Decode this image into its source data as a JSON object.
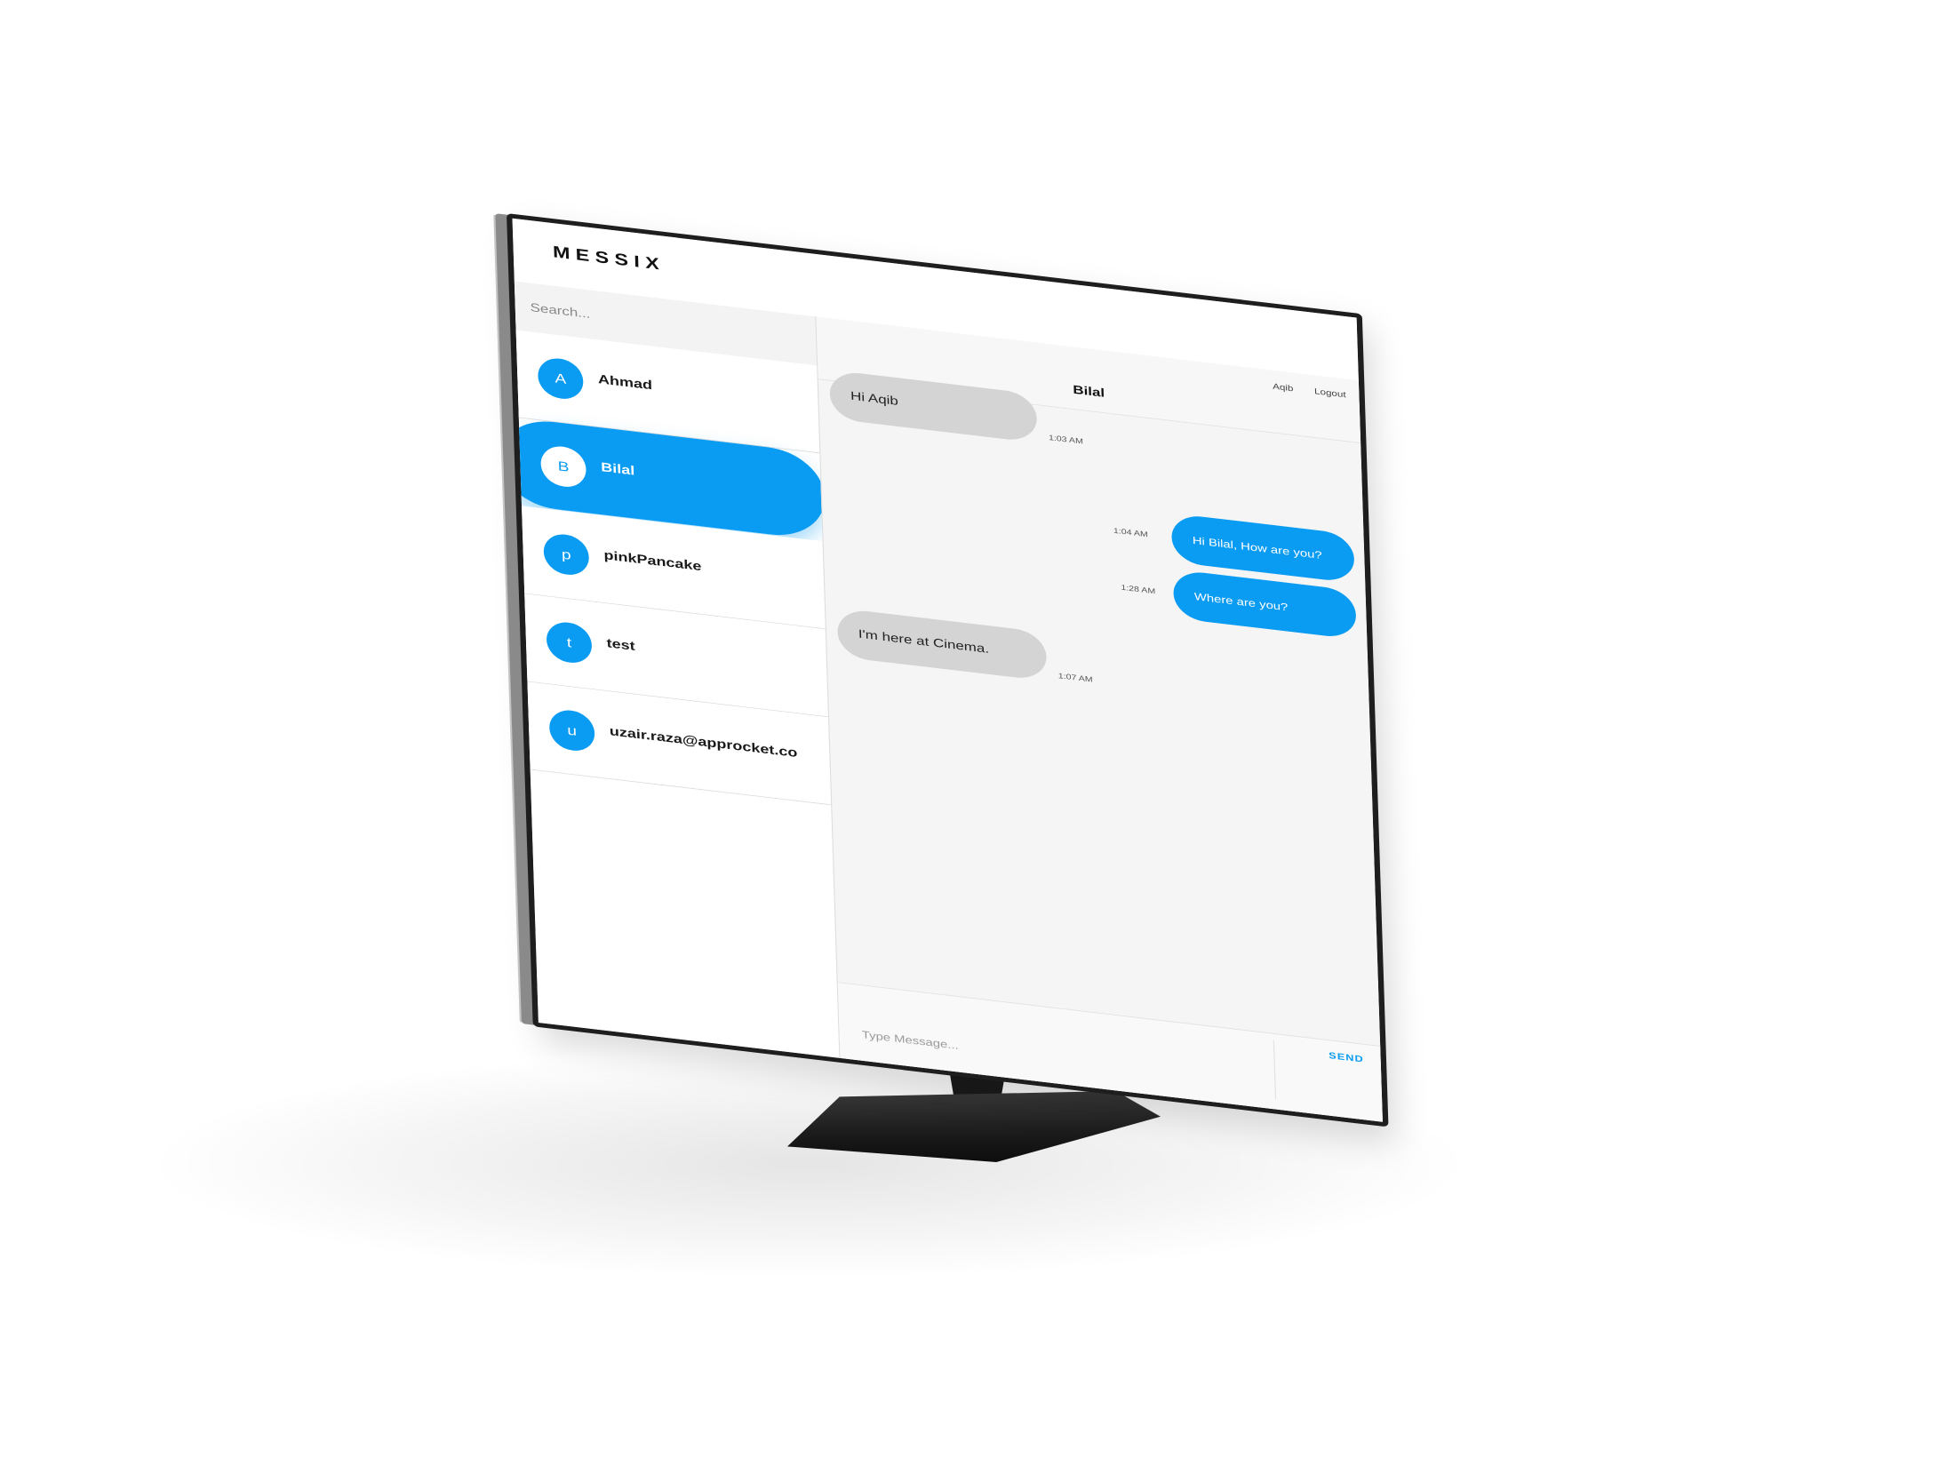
{
  "app": {
    "brand": "MESSIX"
  },
  "search": {
    "placeholder": "Search..."
  },
  "contacts": [
    {
      "initial": "A",
      "name": "Ahmad",
      "active": false
    },
    {
      "initial": "B",
      "name": "Bilal",
      "active": true
    },
    {
      "initial": "p",
      "name": "pinkPancake",
      "active": false
    },
    {
      "initial": "t",
      "name": "test",
      "active": false
    },
    {
      "initial": "u",
      "name": "uzair.raza@approcket.co",
      "active": false
    }
  ],
  "chat": {
    "title": "Bilal",
    "current_user": "Aqib",
    "logout_label": "Logout",
    "messages": [
      {
        "direction": "in",
        "text": "Hi Aqib",
        "time": "1:03 AM"
      },
      {
        "direction": "out",
        "text": "Hi Bilal, How are you?",
        "time": "1:04 AM"
      },
      {
        "direction": "out",
        "text": "Where are you?",
        "time": "1:28 AM"
      },
      {
        "direction": "in",
        "text": "I'm here at Cinema.",
        "time": "1:07 AM"
      }
    ]
  },
  "composer": {
    "placeholder": "Type Message...",
    "send_label": "SEND"
  },
  "colors": {
    "accent": "#0a9bf2",
    "incoming_bubble": "#d4d4d4",
    "chat_background": "#f5f5f5"
  }
}
